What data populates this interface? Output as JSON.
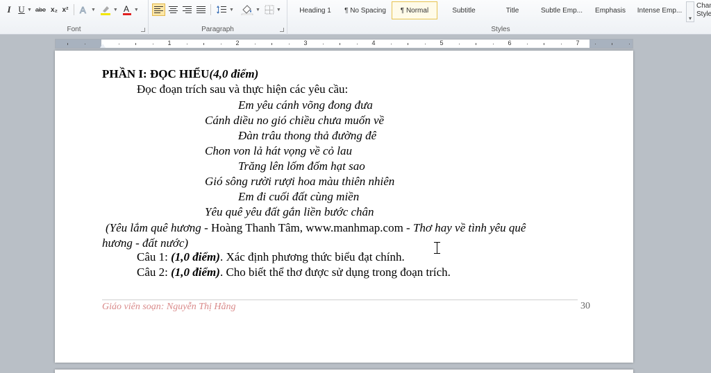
{
  "ribbon": {
    "font_group": {
      "label": "Font",
      "italic": "I",
      "underline": "U",
      "strike": "abe",
      "subscript": "x₂",
      "superscript": "x²"
    },
    "paragraph_group": {
      "label": "Paragraph"
    },
    "styles_group": {
      "label": "Styles",
      "items": [
        "Heading 1",
        "¶ No Spacing",
        "¶ Normal",
        "Subtitle",
        "Title",
        "Subtle Emp...",
        "Emphasis",
        "Intense Emp..."
      ],
      "selected": "¶ Normal",
      "change_styles": "Change Styles"
    }
  },
  "ruler": {
    "numbers": [
      "1",
      "2",
      "3",
      "4",
      "5",
      "6",
      "7"
    ]
  },
  "document": {
    "heading": "PHẦN I: ĐỌC HIỂU",
    "heading_points": "(4,0 điểm)",
    "intro": "Đọc đoạn trích sau và thực hiện các yêu cầu:",
    "poem": [
      "Em yêu cánh võng đong đưa",
      "Cánh diều no gió chiều chưa muốn về",
      "Đàn trâu thong thả đường đê",
      "Chon von lả hát vọng về cỏ lau",
      "Trăng lên lốm đốm hạt sao",
      "Gió sông rười rượi hoa màu thiên nhiên",
      "Em đi cuối đất cùng miền",
      "Yêu quê yêu đất gắn liền bước chân"
    ],
    "source_1a": "(Yêu lắm quê hương",
    "source_1b": " - Hoàng Thanh Tâm, www.manhmap.com - ",
    "source_1c": "Thơ hay về tình yêu quê",
    "source_2": "hương - đất nước)",
    "q1_label": "Câu 1: ",
    "q1_points": "(1,0 điểm)",
    "q1_text": ". Xác định phương thức biểu đạt chính.",
    "q2_label": "Câu 2: ",
    "q2_points": "(1,0 điểm)",
    "q2_text": ". Cho biết thể thơ được sử dụng trong đoạn trích.",
    "footer_author": "Giáo viên soạn: Nguyễn Thị Hằng",
    "page_number": "30"
  },
  "colors": {
    "footer_text": "#d98a8a",
    "selected_style_border": "#e8c34e"
  }
}
